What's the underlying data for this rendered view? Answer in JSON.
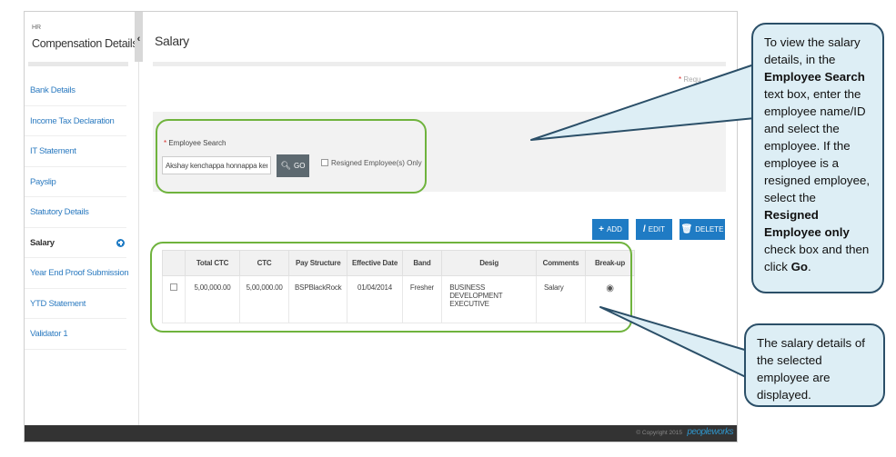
{
  "sidebar": {
    "category": "HR",
    "title": "Compensation Details",
    "toggle_glyph": "‹",
    "items": [
      {
        "label": "Bank Details"
      },
      {
        "label": "Income Tax Declaration"
      },
      {
        "label": "IT Statement"
      },
      {
        "label": "Payslip"
      },
      {
        "label": "Statutory Details"
      },
      {
        "label": "Salary"
      },
      {
        "label": "Year End Proof Submission"
      },
      {
        "label": "YTD Statement"
      },
      {
        "label": "Validator 1"
      }
    ]
  },
  "page": {
    "title": "Salary",
    "required_note": "Requ"
  },
  "search": {
    "label": "Employee Search",
    "value": "Akshay kenchappa honnappa kenc",
    "go_label": "GO",
    "resigned_label": "Resigned Employee(s) Only"
  },
  "actions": {
    "add": "ADD",
    "edit": "EDIT",
    "delete": "DELETE"
  },
  "table": {
    "headers": [
      "Total CTC",
      "CTC",
      "Pay Structure",
      "Effective Date",
      "Band",
      "Desig",
      "Comments",
      "Break-up"
    ],
    "rows": [
      {
        "total_ctc": "5,00,000.00",
        "ctc": "5,00,000.00",
        "pay_structure": "BSPBlackRock",
        "effective_date": "01/04/2014",
        "band": "Fresher",
        "desig_line1": "BUSINESS",
        "desig_line2": "DEVELOPMENT",
        "desig_line3": "EXECUTIVE",
        "comments": "Salary"
      }
    ]
  },
  "footer": {
    "copyright": "© Copyright 2015",
    "brand": "peopleworks"
  },
  "callouts": {
    "top": {
      "t1": "To view the salary details, in the ",
      "b1": "Employee Search",
      "t2": " text box, enter the employee name/ID and select the employee. If the employee is a resigned employee, select the ",
      "b2": "Resigned Employee only",
      "t3": " check box and then click ",
      "b3": "Go",
      "t4": "."
    },
    "bottom": {
      "text": "The salary details of the selected employee are displayed."
    }
  },
  "colors": {
    "link_blue": "#2e7cc1",
    "button_blue": "#1f7bc4",
    "highlight_green": "#6fb33d",
    "callout_fill": "#ddeef5",
    "callout_border": "#2b4f68"
  }
}
